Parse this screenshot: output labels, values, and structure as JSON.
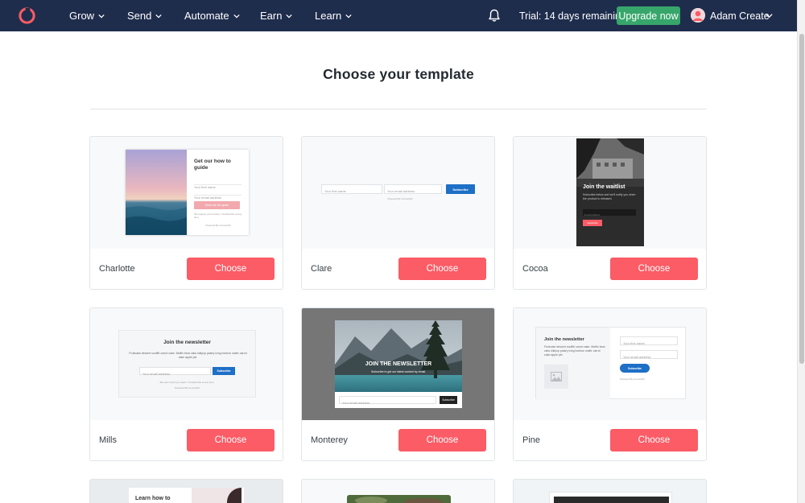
{
  "nav": {
    "items": [
      {
        "label": "Grow"
      },
      {
        "label": "Send"
      },
      {
        "label": "Automate"
      },
      {
        "label": "Earn"
      },
      {
        "label": "Learn"
      }
    ],
    "trial": "Trial: 14 days remaining",
    "upgrade_label": "Upgrade now",
    "user_name": "Adam Create"
  },
  "page": {
    "title": "Choose your template"
  },
  "templates": [
    {
      "name": "Charlotte",
      "choose_label": "Choose"
    },
    {
      "name": "Clare",
      "choose_label": "Choose"
    },
    {
      "name": "Cocoa",
      "choose_label": "Choose"
    },
    {
      "name": "Mills",
      "choose_label": "Choose"
    },
    {
      "name": "Monterey",
      "choose_label": "Choose"
    },
    {
      "name": "Pine",
      "choose_label": "Choose"
    }
  ],
  "previews": {
    "charlotte": {
      "heading": "Get our how to guide",
      "field1": "Your first name",
      "field2": "Your email address",
      "button": "Send me the guide",
      "note": "We respect your privacy. Unsubscribe at any time.",
      "powered": "Powered By ConvertKit"
    },
    "clare": {
      "field1": "Your first name",
      "field2": "Your email address",
      "button": "Subscribe",
      "powered": "Powered By ConvertKit"
    },
    "cocoa": {
      "heading": "Join the waitlist",
      "body": "Subscribe below and we'll notify you when the product is released.",
      "field": "Email Address",
      "button": "Subscribe"
    },
    "mills": {
      "heading": "Join the newsletter",
      "body": "Fruitcake dessert soufflé carrot cake. Muffin bear claw lollipop pastry icing bonbon wafer carrot cake apple pie.",
      "field": "Your email address",
      "button": "Subscribe",
      "note": "We won't send you spam. Unsubscribe at any time.",
      "powered": "Powered By ConvertKit"
    },
    "monterey": {
      "heading": "JOIN THE NEWSLETTER",
      "body": "Subscribe to get our latest content by email.",
      "field": "Your email address",
      "button": "Subscribe"
    },
    "pine": {
      "heading": "Join the newsletter",
      "body": "Fruitcake dessert soufflé carrot cake. Muffin bear claw lollipop pastry icing bonbon wafer carrot cake apple pie.",
      "field1": "Your first name",
      "field2": "Your email address",
      "button": "Subscribe",
      "powered": "Powered By ConvertKit"
    },
    "row3_first": {
      "heading": "Learn how to"
    }
  },
  "colors": {
    "nav_bg": "#1f2d4d",
    "upgrade_bg": "#37a66b",
    "choose_bg": "#fb5c66",
    "brand_red": "#fb5c66",
    "subscribe_blue": "#1e6fc6"
  },
  "icons": {
    "logo": "convertkit-logo-icon",
    "bell": "bell-icon",
    "chevron": "chevron-down-icon"
  }
}
